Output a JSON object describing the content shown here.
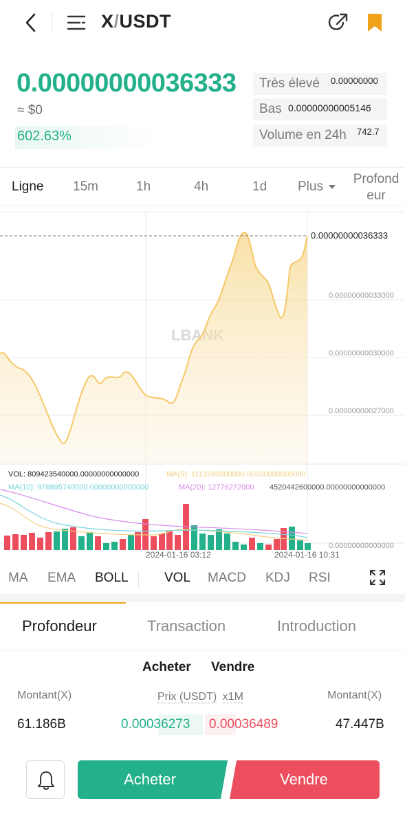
{
  "header": {
    "pair_base": "X",
    "pair_slash": "/",
    "pair_quote": "USDT"
  },
  "ticker": {
    "last_price": "0.00000000036333",
    "usd_value": "≈ $0",
    "change_pct": "602.63%",
    "high_label": "Très élevé",
    "high_value": "0.00000000",
    "low_label": "Bas",
    "low_value": "0.00000000005146",
    "volume_label": "Volume en 24h",
    "volume_value": "742.7"
  },
  "timeframes": {
    "line": "Ligne",
    "m15": "15m",
    "h1": "1h",
    "h4": "4h",
    "d1": "1d",
    "more": "Plus",
    "depth_1": "Profond",
    "depth_2": "eur"
  },
  "chart_text": {
    "watermark": "LBANK",
    "price_tag": "0.00000000036333",
    "y_labels": [
      "0.00000000033000",
      "0.00000000030000",
      "0.00000000027000"
    ],
    "vol_line": "VOL: 809423540000.00000000000000",
    "ma5": "MA(5): 1113240900000.00000000000000",
    "ma10": "MA(10): 976895740000.00000000000000",
    "ma20": "MA(20): 12776272000",
    "vol_max": "4520442600000.00000000000000",
    "vol_zero": "0.00000000000000",
    "time_1": "2024-01-16 03:12",
    "time_2": "2024-01-16 10:31"
  },
  "indicators": {
    "ma": "MA",
    "ema": "EMA",
    "boll": "BOLL",
    "vol": "VOL",
    "macd": "MACD",
    "kdj": "KDJ",
    "rsi": "RSI"
  },
  "section_tabs": {
    "depth": "Profondeur",
    "trades": "Transaction",
    "intro": "Introduction"
  },
  "orderbook": {
    "buy_tab": "Acheter",
    "sell_tab": "Vendre",
    "amount_left": "Montant(X)",
    "price_label": "Prix (USDT)",
    "multiplier": "x1M",
    "amount_right": "Montant(X)",
    "bid_amount": "61.186B",
    "bid_price": "0.00036273",
    "ask_price": "0.00036489",
    "ask_amount": "47.447B"
  },
  "actions": {
    "buy": "Acheter",
    "sell": "Vendre"
  },
  "colors": {
    "green": "#23b08a",
    "red": "#ec4e5e",
    "accent": "#f0a31a",
    "line": "#f5c867"
  }
}
